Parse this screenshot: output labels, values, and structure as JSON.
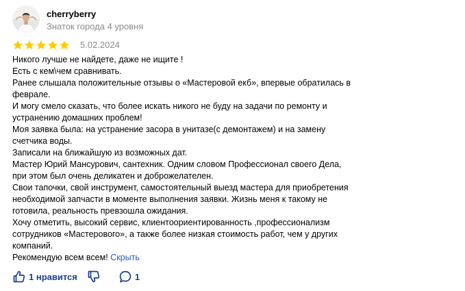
{
  "review": {
    "author": {
      "name": "cherryberry",
      "level": "Знаток города 4 уровня"
    },
    "rating": {
      "stars": 5,
      "max": 5,
      "color": "#fc0"
    },
    "date": "5.02.2024",
    "text_lines": [
      "Никого лучше не найдете, даже не ищите !",
      "Есть с кем\\чем сравнивать.",
      "Ранее слышала положительные отзывы о «Мастеровой екб», впервые обратилась в",
      "феврале.",
      "И могу смело сказать, что более искать никого не буду на задачи по ремонту и",
      "устранению домашних проблем!",
      "Моя заявка была: на устранение засора в унитазе(с демонтажем) и на замену",
      "счетчика воды.",
      "Записали на ближайшую из возможных дат.",
      "Мастер Юрий Мансурович, сантехник. Одним словом Профессионал своего Дела,",
      "при этом был очень деликатен и доброжелателен.",
      "Свои тапочки, свой инструмент, самостоятельный выезд мастера для приобретения",
      "необходимой запчасти в моменте выполнения заявки. Жизнь меня к такому не",
      "готовила, реальность превзошла ожидания.",
      "Хочу отметить, высокий сервис, клиентоориентированность ,профессионализм",
      "сотрудников «Мастерового», а также более низкая стоимость работ, чем у других",
      "компаний.",
      "Рекомендую всем всем!"
    ],
    "collapse_label": "Скрыть",
    "actions": {
      "like_label": "1 нравится",
      "comments_count": "1"
    },
    "colors": {
      "link": "#1a5dd0",
      "action": "#1b3f8f",
      "muted": "#8a8a8a"
    },
    "icons": {
      "like": "thumbs-up-icon",
      "dislike": "thumbs-down-icon",
      "comment": "comment-bubble-icon"
    }
  }
}
